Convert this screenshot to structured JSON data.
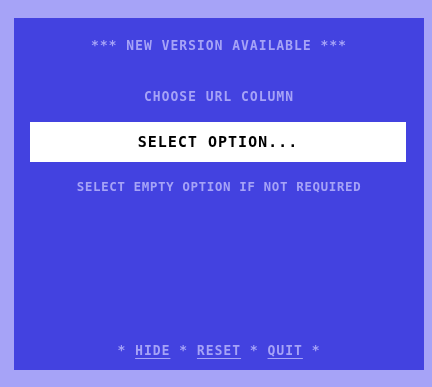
{
  "banner": "*** NEW VERSION AVAILABLE ***",
  "prompt": "CHOOSE URL COLUMN",
  "select": {
    "value": "SELECT OPTION..."
  },
  "hint": "SELECT EMPTY OPTION IF NOT REQUIRED",
  "footer": {
    "sep": "*",
    "hide_label": "HIDE",
    "reset_label": "RESET",
    "quit_label": "QUIT"
  },
  "colors": {
    "outer_bg": "#a6a3f7",
    "panel_bg": "#4342e0",
    "text": "#a6a3f7",
    "select_bg": "#ffffff",
    "select_text": "#000000"
  }
}
